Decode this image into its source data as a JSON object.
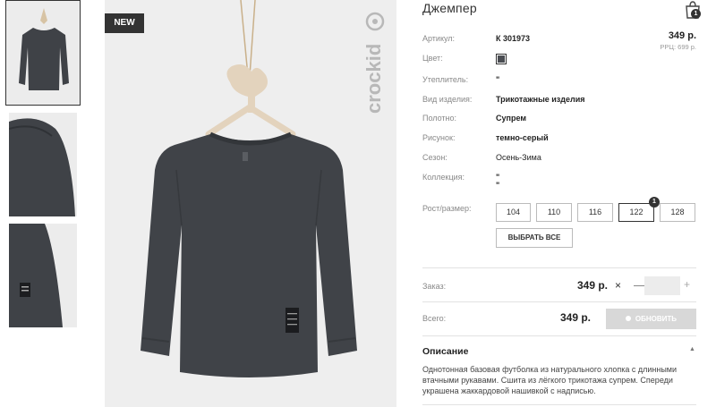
{
  "product": {
    "title": "Джемпер",
    "badge": "NEW",
    "brand": "crockid",
    "price": "349 р.",
    "rrp": "РРЦ: 699 р.",
    "cart_count": "1"
  },
  "attributes": [
    {
      "label": "Артикул:",
      "value": "К 301973"
    },
    {
      "label": "Цвет:",
      "value": ""
    },
    {
      "label": "Утеплитель:",
      "value": "\""
    },
    {
      "label": "Вид изделия:",
      "value": "Трикотажные изделия"
    },
    {
      "label": "Полотно:",
      "value": "Супрем"
    },
    {
      "label": "Рисунок:",
      "value": "темно-серый"
    },
    {
      "label": "Сезон:",
      "value": "Осень-Зима"
    },
    {
      "label": "Коллекция:",
      "value": "\""
    },
    {
      "label": "",
      "value": "\""
    }
  ],
  "colors": {
    "swatch": "#4a4d52",
    "accent": "#333333"
  },
  "sizes": {
    "label": "Рост/размер:",
    "options": [
      "104",
      "110",
      "116",
      "122",
      "128"
    ],
    "selected": "122",
    "selected_count": "1",
    "select_all": "ВЫБРАТЬ ВСЕ"
  },
  "order": {
    "label": "Заказ:",
    "price": "349 р.",
    "remove": "×",
    "minus": "—",
    "plus": "+",
    "qty": ""
  },
  "total": {
    "label": "Всего:",
    "price": "349 р.",
    "refresh": "ОБНОВИТЬ"
  },
  "description": {
    "title": "Описание",
    "text": "Однотонная базовая футболка из натурального хлопка с длинными втачными рукавами. Сшита из лёгкого трикотажа супрем. Спереди украшена жаккардовой нашивкой с надписью."
  },
  "garment_label": [
    "More",
    "good",
    "vibes"
  ],
  "icons": [
    "cart-icon",
    "close-icon",
    "caret-up-icon",
    "hanger-icon"
  ]
}
